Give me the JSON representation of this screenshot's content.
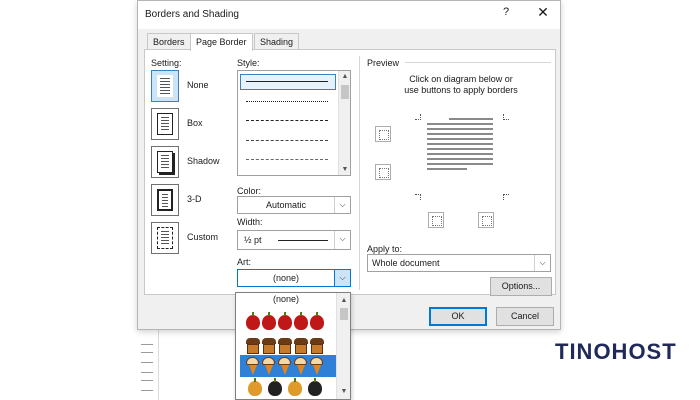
{
  "window": {
    "title": "Borders and Shading",
    "help_label": "?",
    "close_label": "✕"
  },
  "tabs": [
    {
      "label": "Borders"
    },
    {
      "label": "Page Border"
    },
    {
      "label": "Shading"
    }
  ],
  "setting": {
    "heading": "Setting:",
    "items": [
      {
        "label": "None",
        "icon": "setting-none-icon",
        "selected": true
      },
      {
        "label": "Box",
        "icon": "setting-box-icon"
      },
      {
        "label": "Shadow",
        "icon": "setting-shadow-icon"
      },
      {
        "label": "3-D",
        "icon": "setting-3d-icon"
      },
      {
        "label": "Custom",
        "icon": "setting-custom-icon"
      }
    ]
  },
  "style": {
    "heading": "Style:"
  },
  "color": {
    "heading": "Color:",
    "value": "Automatic"
  },
  "width": {
    "heading": "Width:",
    "value": "½ pt"
  },
  "art": {
    "heading": "Art:",
    "value": "(none)",
    "dropdown_options": [
      {
        "label": "(none)"
      },
      {
        "icon": "apple-art-icon"
      },
      {
        "icon": "cupcake-art-icon",
        "selected": true
      },
      {
        "icon": "ice-cream-art-icon"
      },
      {
        "icon": "misc-art-icon"
      }
    ]
  },
  "preview": {
    "heading": "Preview",
    "instructions_line1": "Click on diagram below or",
    "instructions_line2": "use buttons to apply borders"
  },
  "apply_to": {
    "heading": "Apply to:",
    "value": "Whole document"
  },
  "buttons": {
    "options": "Options...",
    "ok": "OK",
    "cancel": "Cancel"
  },
  "brand": {
    "text": "TINOHOST"
  },
  "colors": {
    "accent": "#0078d7",
    "selection": "#cce4f7",
    "brand": "#1f2a5a"
  }
}
